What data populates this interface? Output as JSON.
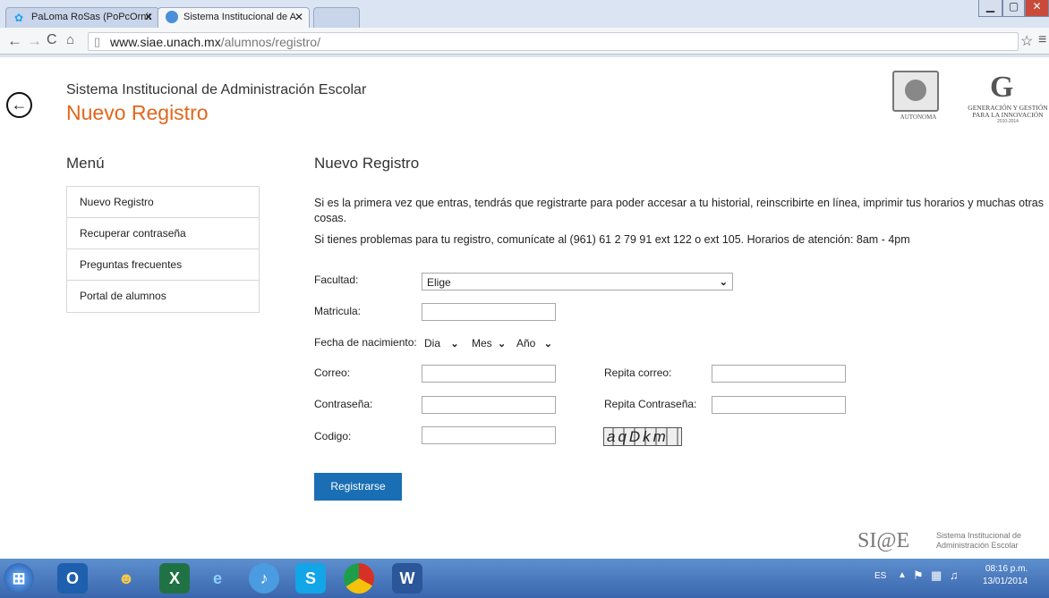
{
  "browser": {
    "tabs": [
      {
        "label": "PaLoma RoSas (PoPcOrnit"
      },
      {
        "label": "Sistema Institucional de A"
      }
    ],
    "url_domain": "www.siae.unach.mx",
    "url_path": "/alumnos/registro/"
  },
  "header": {
    "subtitle": "Sistema Institucional de Administración Escolar",
    "title": "Nuevo Registro",
    "logo_unach_text": "AUTONOMA",
    "logo_gen_line1": "GENERACIÓN Y GESTIÓN",
    "logo_gen_line2": "PARA LA INNOVACIÓN",
    "logo_gen_years": "2010-2014"
  },
  "menu": {
    "title": "Menú",
    "items": [
      {
        "label": "Nuevo Registro"
      },
      {
        "label": "Recuperar contraseña"
      },
      {
        "label": "Preguntas frecuentes"
      },
      {
        "label": "Portal de alumnos"
      }
    ]
  },
  "main": {
    "title": "Nuevo Registro",
    "intro": "Si es la primera vez que entras, tendrás que registrarte para poder accesar a tu historial, reinscribirte en línea, imprimir tus horarios y muchas otras cosas.",
    "support": "Si tienes problemas para tu registro, comunícate al (961) 61 2 79 91 ext 122 o ext 105. Horarios de atención: 8am - 4pm"
  },
  "form": {
    "facultad_label": "Facultad:",
    "facultad_value": "Elige",
    "matricula_label": "Matricula:",
    "fecha_label": "Fecha de nacimiento:",
    "dia": "Dia",
    "mes": "Mes",
    "anio": "Año",
    "correo_label": "Correo:",
    "repita_correo_label": "Repita correo:",
    "contrasena_label": "Contraseña:",
    "repita_contrasena_label": "Repita Contraseña:",
    "codigo_label": "Codigo:",
    "captcha_text": "aqDkm",
    "submit_label": "Registrarse"
  },
  "footer": {
    "logo_text": "SI@E",
    "logo_line1": "Sistema Institucional de",
    "logo_line2": "Administración Escolar"
  },
  "taskbar": {
    "lang": "ES",
    "time": "08:16 p.m.",
    "date": "13/01/2014"
  },
  "colors": {
    "accent": "#e2661b",
    "button": "#1a6fb4"
  }
}
